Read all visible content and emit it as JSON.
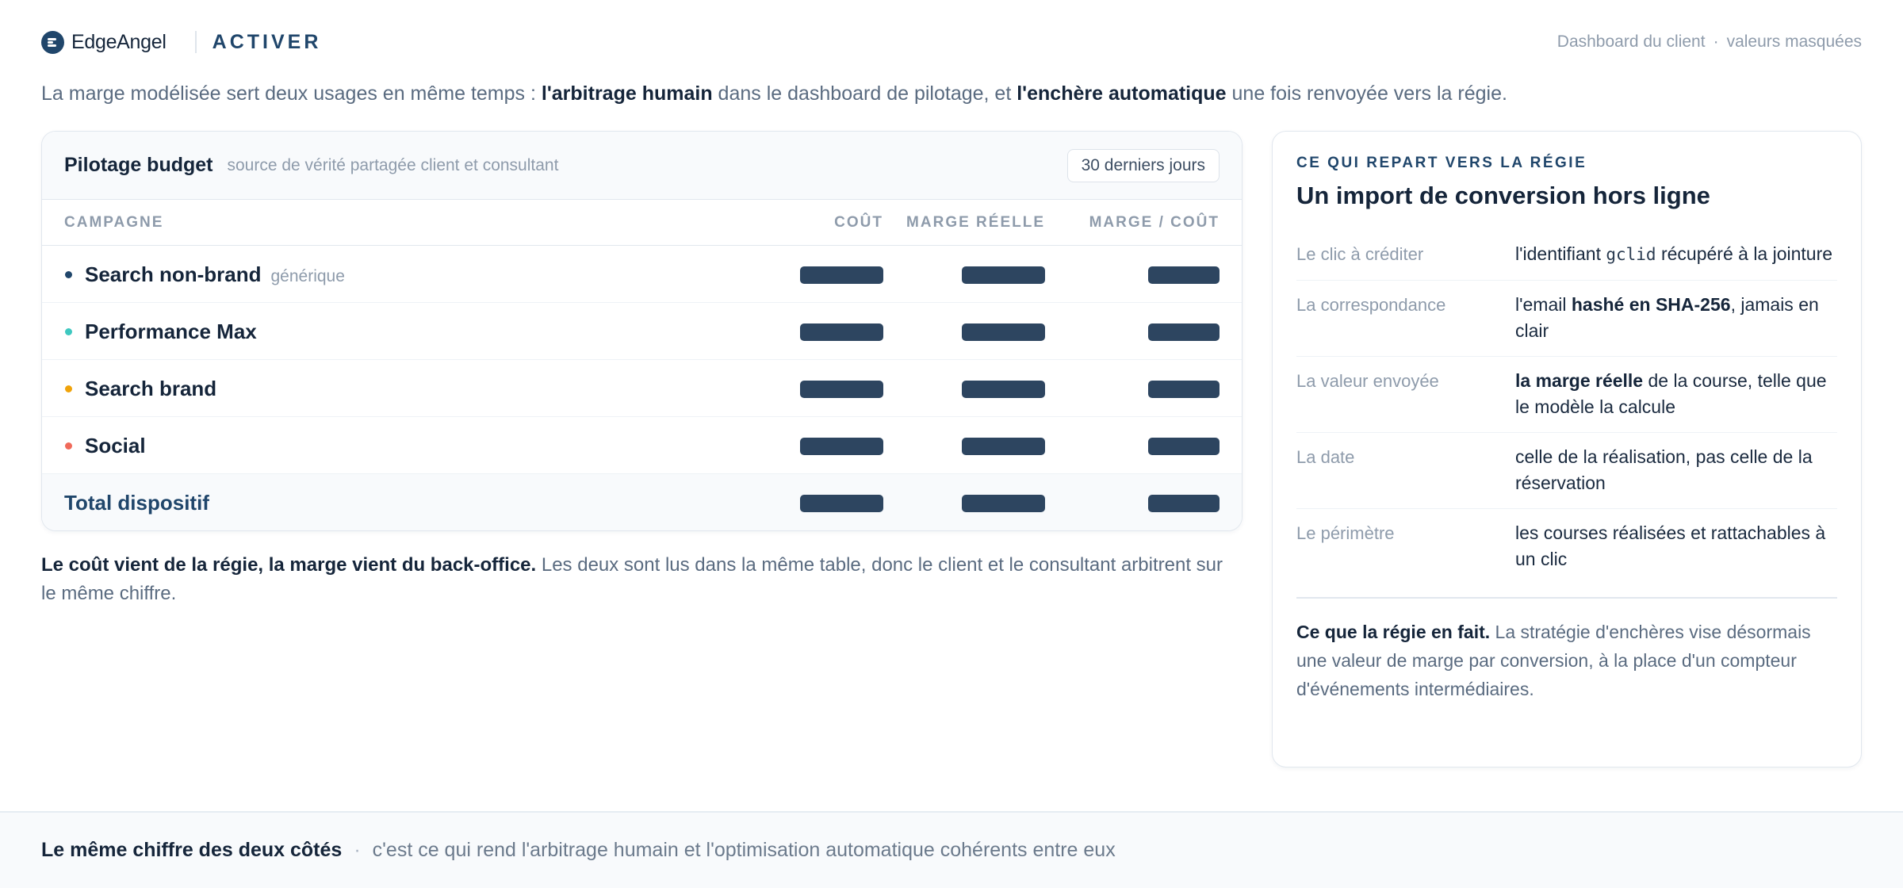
{
  "header": {
    "brand": "EdgeAngel",
    "section": "ACTIVER",
    "context": "Dashboard du client",
    "context_separator": "·",
    "context_note": "valeurs masquées"
  },
  "intro": {
    "part1": "La marge modélisée sert deux usages en même temps : ",
    "bold1": "l'arbitrage humain",
    "part2": " dans le dashboard de pilotage, et ",
    "bold2": "l'enchère automatique",
    "part3": " une fois renvoyée vers la régie."
  },
  "budget": {
    "title": "Pilotage budget",
    "subtitle": "source de vérité partagée client et consultant",
    "period": "30 derniers jours",
    "columns": {
      "campaign": "CAMPAGNE",
      "cost": "COÛT",
      "marge": "MARGE RÉELLE",
      "ratio": "MARGE / COÛT"
    },
    "rows": [
      {
        "name": "Search non-brand",
        "tag": "générique",
        "dot_color": "#20466b"
      },
      {
        "name": "Performance Max",
        "tag": "",
        "dot_color": "#3ec8c0"
      },
      {
        "name": "Search brand",
        "tag": "",
        "dot_color": "#f0a30a"
      },
      {
        "name": "Social",
        "tag": "",
        "dot_color": "#f06a5a"
      }
    ],
    "total_label": "Total dispositif"
  },
  "note": {
    "bold": "Le coût vient de la régie, la marge vient du back-office.",
    "text": " Les deux sont lus dans la même table, donc le client et le consultant arbitrent sur le même chiffre."
  },
  "side": {
    "kicker": "CE QUI REPART VERS LA RÉGIE",
    "title": "Un import de conversion hors ligne",
    "specs": {
      "click": {
        "label": "Le clic à créditer",
        "pre": "l'identifiant ",
        "code": "gclid",
        "post": " récupéré à la jointure"
      },
      "match": {
        "label": "La correspondance",
        "pre": "l'email ",
        "bold": "hashé en SHA-256",
        "post": ", jamais en clair"
      },
      "value": {
        "label": "La valeur envoyée",
        "bold": "la marge réelle",
        "post": " de la course, telle que le modèle la calcule"
      },
      "date": {
        "label": "La date",
        "text": "celle de la réalisation, pas celle de la réservation"
      },
      "scope": {
        "label": "Le périmètre",
        "text": "les courses réalisées et rattachables à un clic"
      }
    },
    "footer_bold": "Ce que la régie en fait.",
    "footer_text": " La stratégie d'enchères vise désormais une valeur de marge par conversion, à la place d'un compteur d'événements intermédiaires."
  },
  "footer": {
    "strong": "Le même chiffre des deux côtés",
    "separator": "·",
    "text": "c'est ce qui rend l'arbitrage humain et l'optimisation automatique cohérents entre eux"
  }
}
